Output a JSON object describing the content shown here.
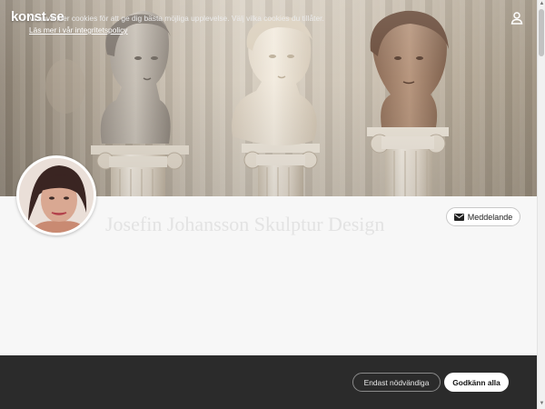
{
  "header": {
    "logo_text": "konst.se",
    "user_icon": "user-icon"
  },
  "profile": {
    "name": "Josefin Johansson Skulptur Design",
    "message_button_label": "Meddelande",
    "message_icon": "mail-icon"
  },
  "cookie_banner": {
    "text": "Vi använder cookies för att ge dig bästa möjliga upplevelse. Välj vilka cookies du tillåter.",
    "policy_link": "Läs mer i vår integritetspolicy",
    "necessary_button": "Endast nödvändiga",
    "accept_button": "Godkänn alla"
  },
  "colors": {
    "cookie_background": "#2b2b2b",
    "page_background": "#f7f7f7"
  }
}
